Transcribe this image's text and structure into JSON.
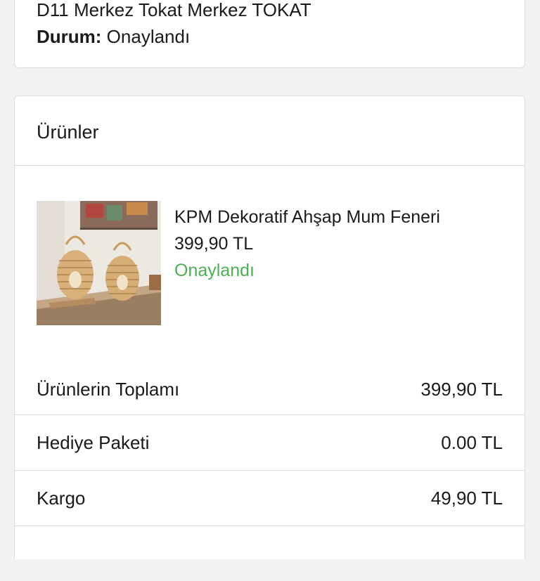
{
  "address": {
    "line": "D11 Merkez Tokat Merkez TOKAT",
    "status_label": "Durum:",
    "status_value": "Onaylandı"
  },
  "products": {
    "title": "Ürünler",
    "items": [
      {
        "name": "KPM Dekoratif Ahşap Mum Feneri",
        "price": "399,90 TL",
        "status": "Onaylandı",
        "status_color": "#4caf50",
        "image_icon": "bamboo-lantern-product-photo"
      }
    ]
  },
  "summary": {
    "rows": [
      {
        "label": "Ürünlerin Toplamı",
        "value": "399,90 TL"
      },
      {
        "label": "Hediye Paketi",
        "value": "0.00 TL"
      },
      {
        "label": "Kargo",
        "value": "49,90 TL"
      }
    ]
  }
}
